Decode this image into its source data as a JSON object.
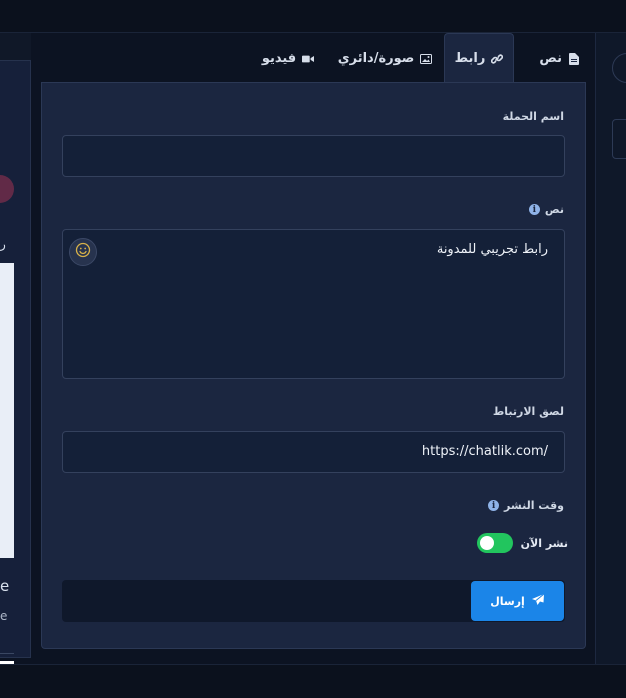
{
  "left_preview": {
    "text1": "ر",
    "text2": "e",
    "text3": "e"
  },
  "tabs": [
    {
      "label": "نص",
      "icon": "file-icon"
    },
    {
      "label": "رابط",
      "icon": "link-icon",
      "active": true
    },
    {
      "label": "صورة/دائري",
      "icon": "image-icon"
    },
    {
      "label": "فيديو",
      "icon": "video-icon"
    }
  ],
  "form": {
    "campaign_name_label": "اسم الحملة",
    "campaign_name_value": "",
    "text_label": "نص",
    "text_value": "رابط تجريبي للمدونة",
    "link_label": "لصق الارتباط",
    "link_value": "https://chatlik.com/",
    "publish_time_label": "وقت النشر",
    "publish_now_label": "نشر الآن",
    "publish_now_enabled": true,
    "send_label": "إرسال"
  },
  "colors": {
    "accent": "#1b85e8",
    "toggle_on": "#22c55e",
    "panel_bg": "#1b2640"
  }
}
